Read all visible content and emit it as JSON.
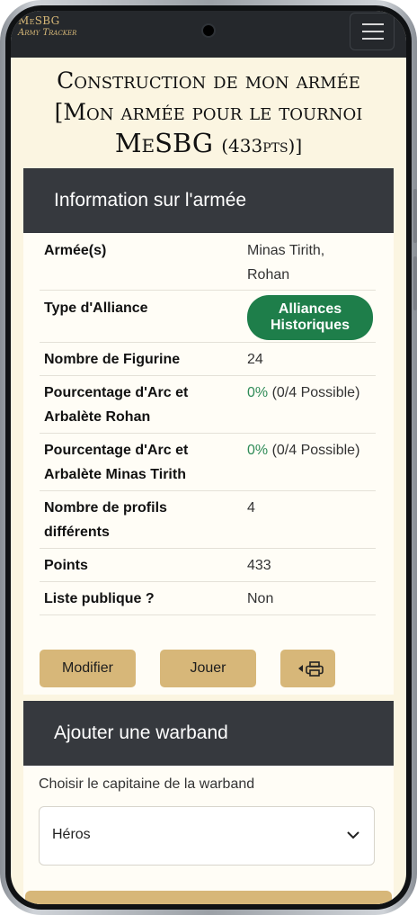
{
  "navbar": {
    "brand_line1": "MeSBG",
    "brand_line2": "Army Tracker",
    "menu_icon": "hamburger-icon"
  },
  "title": {
    "line1": "Construction de mon armée",
    "line2": "[Mon armée pour le tournoi",
    "line3": "MeSBG",
    "line3_pts": "(433pts)]"
  },
  "info": {
    "header": "Information sur l'armée",
    "rows": [
      {
        "label": "Armée(s)",
        "value": "Minas Tirith, Rohan"
      },
      {
        "label": "Type d'Alliance",
        "badge": "Alliances Historiques"
      },
      {
        "label": "Nombre de Figurine",
        "value": "24"
      },
      {
        "label": "Pourcentage d'Arc et Arbalète Rohan",
        "pct": "0%",
        "value": "(0/4 Possible)"
      },
      {
        "label": "Pourcentage d'Arc et Arbalète Minas Tirith",
        "pct": "0%",
        "value": "(0/4 Possible)"
      },
      {
        "label": "Nombre de profils différents",
        "value": "4"
      },
      {
        "label": "Points",
        "value": "433"
      },
      {
        "label": "Liste publique ?",
        "value": "Non"
      }
    ],
    "buttons": {
      "edit": "Modifier",
      "play": "Jouer",
      "print_icon": "print-icon"
    }
  },
  "warband": {
    "header": "Ajouter une warband",
    "captain_label": "Choisir le capitaine de la warband",
    "captain_select": "Héros"
  },
  "colors": {
    "navbar": "#25282c",
    "page_bg": "#fbf5e1",
    "card_header": "#36393e",
    "button": "#d7b779",
    "badge": "#1e7e4a",
    "percent": "#2e8b57"
  }
}
